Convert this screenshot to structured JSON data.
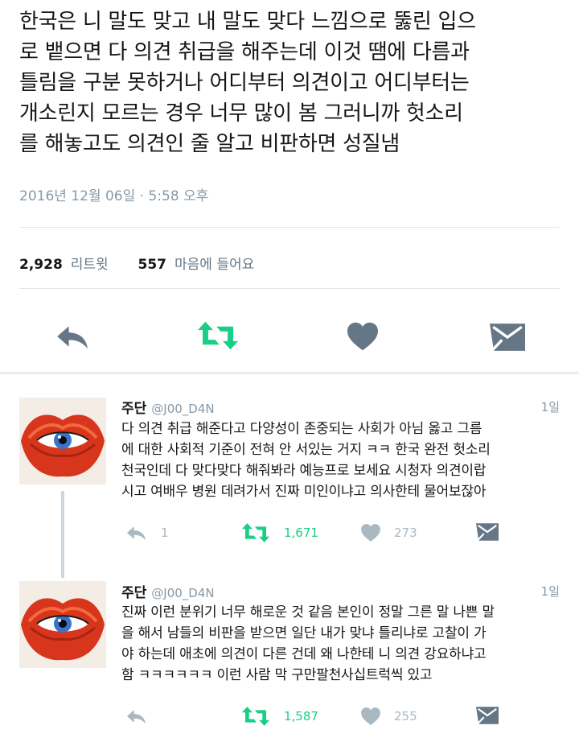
{
  "main_tweet": {
    "text": "한국은 니 말도 맞고 내 말도 맞다 느낌으로 뚫린 입으\n로 뱉으면 다 의견 취급을 해주는데 이것 땜에 다름과\n틀림을 구분 못하거나 어디부터 의견이고 어디부터는\n개소린지 모르는 경우 너무 많이 봄 그러니까 헛소리\n를 해놓고도 의견인 줄 알고 비판하면 성질냄",
    "timestamp": "2016년 12월 06일 · 5:58 오후",
    "retweets_count": "2,928",
    "retweets_label": "리트윗",
    "likes_count": "557",
    "likes_label": "마음에 들어요"
  },
  "replies": [
    {
      "name": "주단",
      "handle": "@J00_D4N",
      "time": "1일",
      "text": "다 의견 취급 해준다고 다양성이 존중되는 사회가 아님 옳고 그름\n에 대한 사회적 기준이 전혀 안 서있는 거지 ㅋㅋ 한국 완전 헛소리\n천국인데 다 맞다맞다 해줘봐라 예능프로 보세요 시청자 의견이랍\n시고 여배우 병원 데려가서 진짜 미인이냐고 의사한테 물어보잖아",
      "reply_count": "1",
      "retweet_count": "1,671",
      "like_count": "273"
    },
    {
      "name": "주단",
      "handle": "@J00_D4N",
      "time": "1일",
      "text": "진짜 이런 분위기 너무 해로운 것 같음 본인이 정말 그른 말 나쁜 말\n을 해서 남들의 비판을 받으면 일단 내가 맞냐 틀리냐로 고찰이 가\n야 하는데 애초에 의견이 다른 건데 왜 나한테 니 의견 강요하냐고\n함 ㅋㅋㅋㅋㅋㅋ 이런 사람 막 구만팔천사십트럭씩 있고",
      "reply_count": "",
      "retweet_count": "1,587",
      "like_count": "255"
    }
  ],
  "icons": {
    "reply": "reply-arrow-icon",
    "retweet": "retweet-icon",
    "like": "heart-icon",
    "dm": "envelope-icon",
    "avatar": "red-lips-eye-avatar"
  },
  "colors": {
    "text": "#14171a",
    "meta": "#8899a6",
    "icon_gray": "#aab8c2",
    "icon_dark": "#657786",
    "retweet_green": "#19cf86",
    "divider": "#e1e8ed"
  }
}
